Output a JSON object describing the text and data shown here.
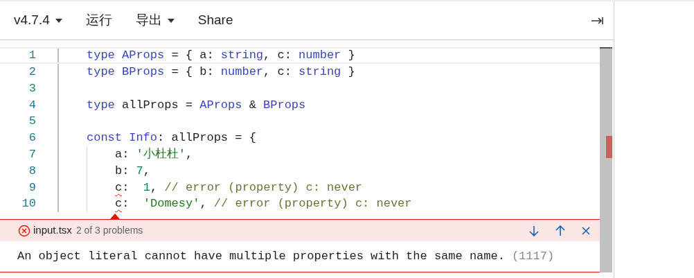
{
  "toolbar": {
    "items": [
      {
        "label": "v4.7.4",
        "dropdown": true
      },
      {
        "label": "运行",
        "dropdown": false
      },
      {
        "label": "导出",
        "dropdown": true
      },
      {
        "label": "Share",
        "dropdown": false
      }
    ]
  },
  "editor": {
    "lines": [
      {
        "number": "1",
        "current": true,
        "indented": false,
        "tokens": [
          {
            "kind": "keyword",
            "text": "type "
          },
          {
            "kind": "type",
            "text": "AProps"
          },
          {
            "kind": "plain",
            "text": " = { a: "
          },
          {
            "kind": "type",
            "text": "string"
          },
          {
            "kind": "plain",
            "text": ", c: "
          },
          {
            "kind": "type",
            "text": "number"
          },
          {
            "kind": "plain",
            "text": " }"
          }
        ]
      },
      {
        "number": "2",
        "current": false,
        "indented": false,
        "tokens": [
          {
            "kind": "keyword",
            "text": "type "
          },
          {
            "kind": "type",
            "text": "BProps"
          },
          {
            "kind": "plain",
            "text": " = { b: "
          },
          {
            "kind": "type",
            "text": "number"
          },
          {
            "kind": "plain",
            "text": ", c: "
          },
          {
            "kind": "type",
            "text": "string"
          },
          {
            "kind": "plain",
            "text": " }"
          }
        ]
      },
      {
        "number": "3",
        "current": false,
        "indented": false
      },
      {
        "number": "4",
        "current": false,
        "indented": false,
        "tokens": [
          {
            "kind": "keyword",
            "text": "type"
          },
          {
            "kind": "plain",
            "text": " allProps = "
          },
          {
            "kind": "type",
            "text": "AProps"
          },
          {
            "kind": "plain",
            "text": " & "
          },
          {
            "kind": "type",
            "text": "BProps"
          }
        ]
      },
      {
        "number": "5",
        "current": false,
        "indented": false
      },
      {
        "number": "6",
        "current": false,
        "indented": false,
        "tokens": [
          {
            "kind": "keyword",
            "text": "const "
          },
          {
            "kind": "type",
            "text": "Info"
          },
          {
            "kind": "plain",
            "text": ": allProps = {"
          }
        ]
      },
      {
        "number": "7",
        "current": false,
        "indented": true,
        "tokens": [
          {
            "kind": "plain",
            "text": "a: "
          },
          {
            "kind": "string",
            "text": "'小杜杜'"
          },
          {
            "kind": "plain",
            "text": ","
          }
        ]
      },
      {
        "number": "8",
        "current": false,
        "indented": true,
        "tokens": [
          {
            "kind": "plain",
            "text": "b: "
          },
          {
            "kind": "number",
            "text": "7"
          },
          {
            "kind": "plain",
            "text": ","
          }
        ]
      },
      {
        "number": "9",
        "current": false,
        "indented": true,
        "tokens": [
          {
            "kind": "plain",
            "text": "c",
            "error": true
          },
          {
            "kind": "plain",
            "text": ":  "
          },
          {
            "kind": "number",
            "text": "1"
          },
          {
            "kind": "plain",
            "text": ", "
          },
          {
            "kind": "comment",
            "text": "// error (property) c: never"
          }
        ]
      },
      {
        "number": "10",
        "current": false,
        "indented": true,
        "tokens": [
          {
            "kind": "plain",
            "text": "c",
            "error": true
          },
          {
            "kind": "plain",
            "text": ":  "
          },
          {
            "kind": "string",
            "text": "'Domesy'"
          },
          {
            "kind": "plain",
            "text": ", "
          },
          {
            "kind": "comment",
            "text": "// error (property) c: never"
          }
        ]
      }
    ]
  },
  "problem_peek": {
    "file": "input.tsx",
    "count": "2 of 3 problems",
    "message": "An object literal cannot have multiple properties with the same name.",
    "code": "(1117)"
  }
}
